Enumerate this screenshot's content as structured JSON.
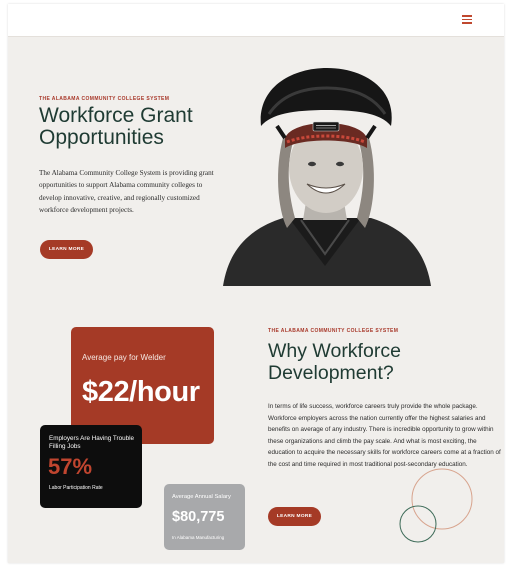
{
  "header": {
    "menu_icon": "hamburger-menu-icon"
  },
  "hero": {
    "eyebrow": "THE ALABAMA COMMUNITY COLLEGE SYSTEM",
    "title": "Workforce Grant Opportunities",
    "body": "The Alabama Community College System is providing grant opportunities to support Alabama community colleges to develop innovative, creative, and regionally customized workforce development projects.",
    "button": "LEARN MORE"
  },
  "stats": {
    "pay": {
      "label": "Average pay for Welder",
      "value": "$22/hour"
    },
    "jobs": {
      "label": "Employers Are Having Trouble Filling Jobs",
      "value": "57%",
      "sub": "Labor Participation Rate"
    },
    "salary": {
      "label": "Average Annual Salary",
      "value": "$80,775",
      "sub": "In Alabama Manufacturing"
    }
  },
  "why": {
    "eyebrow": "THE ALABAMA COMMUNITY COLLEGE SYSTEM",
    "title": "Why Workforce Development?",
    "body": "In terms of life success, workforce careers truly provide the whole package. Workforce employers across the nation currently offer the highest salaries and benefits on average of any industry. There is incredible opportunity to grow within these organizations and climb the pay scale. And what is most exciting, the education to acquire the necessary skills for workforce careers come at a fraction of the cost and time required in most traditional post-secondary education.",
    "button": "LEARN MORE"
  },
  "colors": {
    "accent": "#a53a26",
    "heading": "#1f3b33",
    "background": "#f1efec",
    "card_dark": "#0d0d0d",
    "card_gray": "#a8a9ab"
  }
}
